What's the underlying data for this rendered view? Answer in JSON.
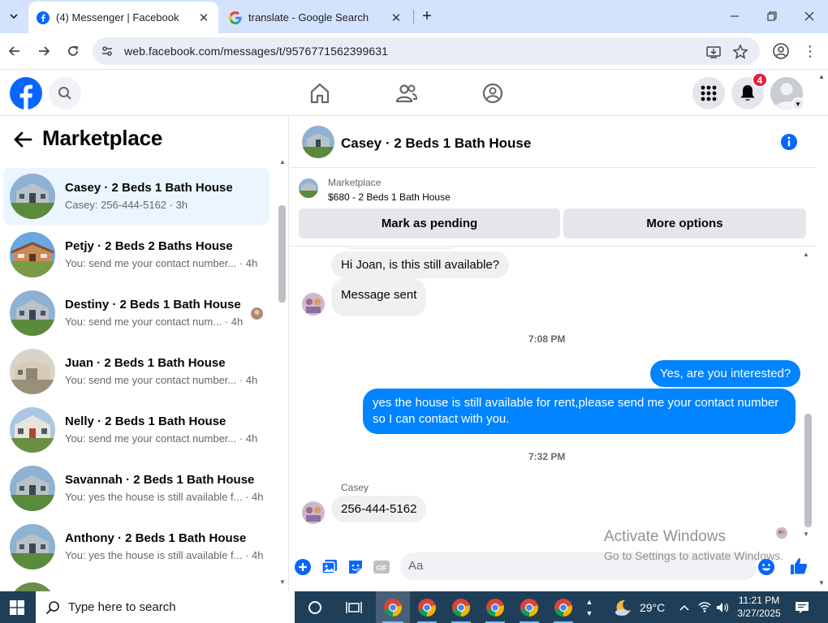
{
  "browser": {
    "tabs": [
      {
        "title": "(4) Messenger | Facebook",
        "active": true
      },
      {
        "title": "translate - Google Search",
        "active": false
      }
    ],
    "url": "web.facebook.com/messages/t/9576771562399631"
  },
  "facebook": {
    "notification_count": "4"
  },
  "left_panel": {
    "title": "Marketplace",
    "conversations": [
      {
        "name": "Casey · 2 Beds 1 Bath House",
        "preview": "Casey: 256-444-5162 · 3h",
        "selected": true
      },
      {
        "name": "Petjy · 2 Beds 2 Baths House",
        "preview": "You: send me your contact number... · 4h"
      },
      {
        "name": "Destiny · 2 Beds 1 Bath House",
        "preview": "You: send me your contact num... · 4h"
      },
      {
        "name": "Juan · 2 Beds 1 Bath House",
        "preview": "You: send me your contact number... · 4h"
      },
      {
        "name": "Nelly · 2 Beds 1 Bath House",
        "preview": "You: send me your contact number... · 4h"
      },
      {
        "name": "Savannah · 2 Beds 1 Bath House",
        "preview": "You: yes the house is still available f... · 4h"
      },
      {
        "name": "Anthony · 2 Beds 1 Bath House",
        "preview": "You: yes the house is still available f... · 4h"
      }
    ]
  },
  "chat": {
    "title": "Casey · 2 Beds 1 Bath House",
    "listing": {
      "label": "Marketplace",
      "price_title": "$680 - 2 Beds 1 Bath House",
      "mark_pending": "Mark as pending",
      "more_options": "More options"
    },
    "messages": {
      "in1": "Hi Joan, is this still available?",
      "in2": "Message sent",
      "ts1": "7:08 PM",
      "out1": "Yes, are you interested?",
      "out2": "yes the house is still available for rent,please send me your contact number so I can contact with you.",
      "ts2": "7:32 PM",
      "sender": "Casey",
      "in3": "256-444-5162"
    },
    "composer_placeholder": "Aa"
  },
  "watermark": {
    "line1": "Activate Windows",
    "line2": "Go to Settings to activate Windows."
  },
  "taskbar": {
    "search_placeholder": "Type here to search",
    "temperature": "29°C",
    "time": "11:21 PM",
    "date": "3/27/2025"
  },
  "colors": {
    "facebook_blue": "#0866ff",
    "messenger_blue": "#0084ff",
    "taskbar": "#1f3e57",
    "tabstrip": "#d3e3fd"
  }
}
